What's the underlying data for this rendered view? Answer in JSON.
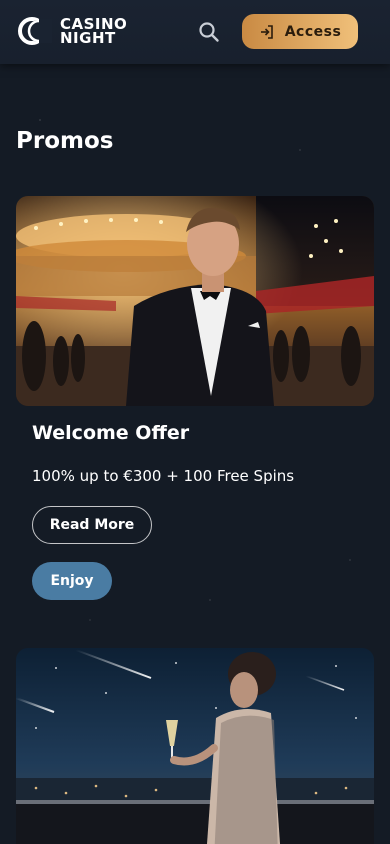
{
  "header": {
    "logo_line1": "CASINO",
    "logo_line2": "NIGHT",
    "access_label": "Access"
  },
  "section": {
    "title": "Promos"
  },
  "promos": [
    {
      "title": "Welcome Offer",
      "description": "100% up to €300 + 100 Free Spins",
      "read_more_label": "Read More",
      "enjoy_label": "Enjoy"
    }
  ],
  "colors": {
    "background": "#141b25",
    "header": "#1a2331",
    "access_gradient_start": "#c98a43",
    "access_gradient_end": "#f0c07a",
    "enjoy_button": "#4a7ca3"
  },
  "icons": {
    "search": "search-icon",
    "access": "login-icon",
    "logo": "crescent-moon-logo"
  }
}
